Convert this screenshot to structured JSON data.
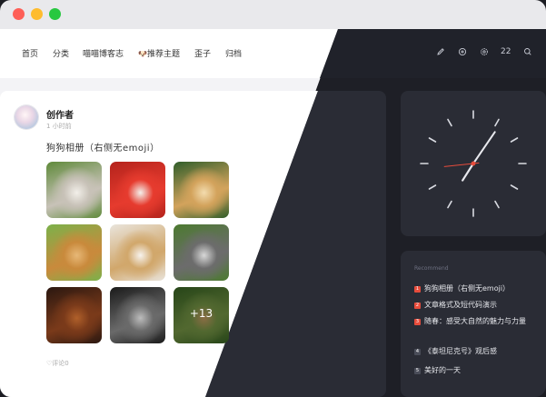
{
  "nav": {
    "items": [
      "首页",
      "分类",
      "喵喵博客志",
      "推荐主题",
      "歪子",
      "归档"
    ],
    "badge_emoji": "🐶",
    "count": "22"
  },
  "post": {
    "author": "创作者",
    "time": "1 小时前",
    "title": "狗狗相册（右侧无emoji）",
    "photos": [
      {
        "name": "golden-retriever-profile",
        "colors": [
          "#5f8a3a",
          "#c8c2b8",
          "#f2efe9"
        ]
      },
      {
        "name": "puppy-in-red-flowers",
        "colors": [
          "#b4231c",
          "#e63b2e",
          "#f4f1ec"
        ]
      },
      {
        "name": "labrador-on-green",
        "colors": [
          "#2f5d2a",
          "#d3a35c",
          "#f3dcae"
        ]
      },
      {
        "name": "golden-smiling",
        "colors": [
          "#7bb14a",
          "#c98a3c",
          "#e7b877"
        ]
      },
      {
        "name": "puppy-with-bowl",
        "colors": [
          "#e9e4dc",
          "#d1a76b",
          "#f7f3ee"
        ]
      },
      {
        "name": "husky-on-grass",
        "colors": [
          "#4c7a30",
          "#6c6c6c",
          "#d8d8d8"
        ]
      },
      {
        "name": "brown-dog-dark",
        "colors": [
          "#2a1710",
          "#7a3a1a",
          "#b0602a"
        ]
      },
      {
        "name": "pug-black-white",
        "colors": [
          "#1a1a1a",
          "#6a6a6a",
          "#bcbcbc"
        ]
      },
      {
        "name": "golden-lying-grass",
        "colors": [
          "#3c6b26",
          "#7ea04a",
          "#d5a86a"
        ]
      }
    ],
    "more_count": "+13",
    "comments": "评论0"
  },
  "recommend": {
    "title": "Recommend",
    "items": [
      {
        "num": "1",
        "text": "狗狗相册（右侧无emoji）",
        "color": "#e74c3c"
      },
      {
        "num": "2",
        "text": "文章格式及短代码演示",
        "color": "#e74c3c"
      },
      {
        "num": "3",
        "text": "随春：感受大自然的魅力与力量",
        "color": "#e74c3c"
      },
      {
        "num": "4",
        "text": "《泰坦尼克号》观后感",
        "color": "#4a4d59"
      },
      {
        "num": "5",
        "text": "美好的一天",
        "color": "#4a4d59"
      }
    ]
  },
  "clock": {
    "hour": 7,
    "minute": 5,
    "second": 44
  },
  "colors": {
    "accent": "#e74c3c",
    "dark_card": "#2a2c35",
    "page_dark": "#1e1f26",
    "page_light": "#f3f3f6"
  }
}
